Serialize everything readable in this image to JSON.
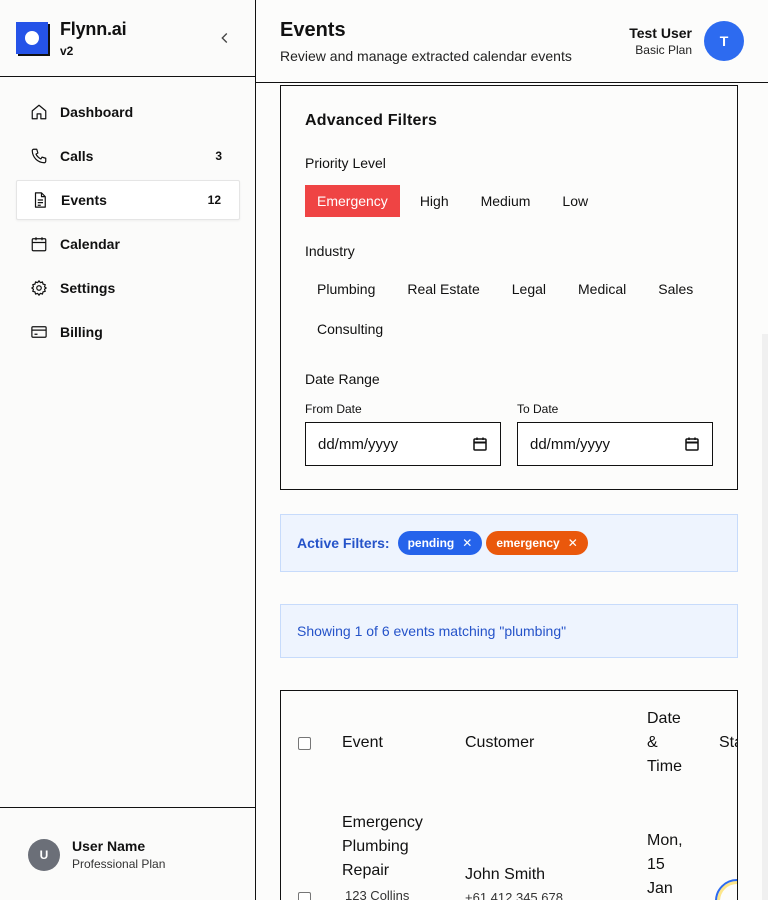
{
  "brand": {
    "name": "Flynn.ai",
    "version": "v2"
  },
  "nav": {
    "items": [
      {
        "label": "Dashboard",
        "count": ""
      },
      {
        "label": "Calls",
        "count": "3"
      },
      {
        "label": "Events",
        "count": "12"
      },
      {
        "label": "Calendar",
        "count": ""
      },
      {
        "label": "Settings",
        "count": ""
      },
      {
        "label": "Billing",
        "count": ""
      }
    ]
  },
  "sidebar_user": {
    "initial": "U",
    "name": "User Name",
    "plan": "Professional Plan"
  },
  "header": {
    "title": "Events",
    "subtitle": "Review and manage extracted calendar events",
    "user_name": "Test User",
    "user_plan": "Basic Plan",
    "avatar_initial": "T"
  },
  "filters": {
    "title": "Advanced Filters",
    "priority_label": "Priority Level",
    "priority": [
      "Emergency",
      "High",
      "Medium",
      "Low"
    ],
    "priority_selected": "Emergency",
    "industry_label": "Industry",
    "industry": [
      "Plumbing",
      "Real Estate",
      "Legal",
      "Medical",
      "Sales",
      "Consulting"
    ],
    "date_range_label": "Date Range",
    "from_label": "From Date",
    "to_label": "To Date",
    "from_value": "dd/mm/yyyy",
    "to_value": "dd/mm/yyyy"
  },
  "active_filters": {
    "label": "Active Filters:",
    "tags": [
      {
        "text": "pending",
        "color": "#2563eb"
      },
      {
        "text": "emergency",
        "color": "#ea580c"
      }
    ]
  },
  "showing": {
    "text": "Showing 1 of 6 events matching \"plumbing\""
  },
  "table": {
    "headers": {
      "event": "Event",
      "customer": "Customer",
      "date_time_1": "Date",
      "date_time_2": "&",
      "date_time_3": "Time",
      "status": "Sta"
    },
    "rows": [
      {
        "event_1": "Emergency",
        "event_2": "Plumbing",
        "event_3": "Repair",
        "address": "123 Collins",
        "customer": "John Smith",
        "phone": "+61 412 345 678",
        "date_1": "Mon,",
        "date_2": "15",
        "date_3": "Jan"
      }
    ]
  },
  "colors": {
    "accent": "#2553e8",
    "emergency": "#ef4444",
    "info_bg": "#eef4fe",
    "info_text": "#2553c9"
  }
}
